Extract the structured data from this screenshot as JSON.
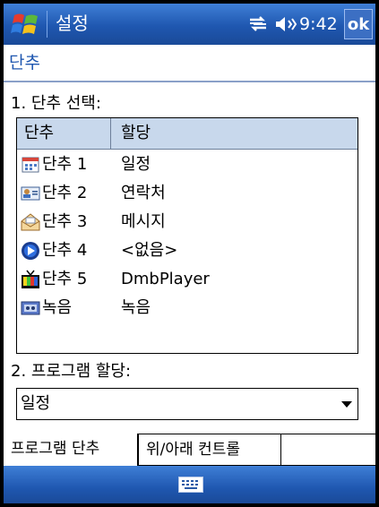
{
  "titlebar": {
    "app_title": "설정",
    "time": "9:42",
    "ok_label": "ok",
    "icons": [
      "windows-start-icon",
      "connectivity-icon",
      "volume-icon"
    ]
  },
  "page": {
    "header": "단추"
  },
  "section1": {
    "label": "1. 단추 선택:"
  },
  "list": {
    "columns": [
      "단추",
      "할당"
    ],
    "rows": [
      {
        "button": "단추 1",
        "assignment": "일정",
        "icon": "calendar-icon"
      },
      {
        "button": "단추 2",
        "assignment": "연락처",
        "icon": "contacts-icon"
      },
      {
        "button": "단추 3",
        "assignment": "메시지",
        "icon": "messaging-icon"
      },
      {
        "button": "단추 4",
        "assignment": "<없음>",
        "icon": "media-play-icon"
      },
      {
        "button": "단추 5",
        "assignment": "DmbPlayer",
        "icon": "tv-icon"
      },
      {
        "button": "녹음",
        "assignment": "녹음",
        "icon": "recorder-icon"
      }
    ]
  },
  "section2": {
    "label": "2. 프로그램 할당:",
    "selected_value": "일정"
  },
  "tabs": [
    {
      "label": "프로그램 단추",
      "active": true
    },
    {
      "label": "위/아래 컨트롤",
      "active": false
    }
  ],
  "menubar": {
    "icon": "keyboard-icon"
  },
  "colors": {
    "titlebar": "#1f57b0",
    "header_text": "#1f57b0",
    "column_header": "#c8d8ec"
  }
}
